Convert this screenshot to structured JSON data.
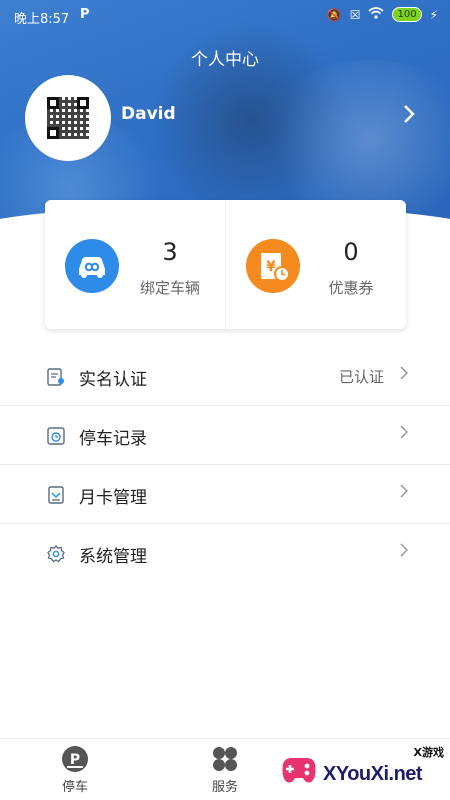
{
  "status_bar": {
    "time": "晚上8:57",
    "app_indicator": "P",
    "battery": "100"
  },
  "header": {
    "title": "个人中心",
    "user_name": "David"
  },
  "stats": [
    {
      "value": "3",
      "label": "绑定车辆",
      "icon": "car-link-icon",
      "color": "#2f8be8"
    },
    {
      "value": "0",
      "label": "优惠券",
      "icon": "coupon-icon",
      "color": "#f58a1f"
    }
  ],
  "menu": [
    {
      "label": "实名认证",
      "value": "已认证",
      "icon": "id-card-icon"
    },
    {
      "label": "停车记录",
      "value": "",
      "icon": "parking-record-icon"
    },
    {
      "label": "月卡管理",
      "value": "",
      "icon": "monthly-card-icon"
    },
    {
      "label": "系统管理",
      "value": "",
      "icon": "settings-icon"
    }
  ],
  "tabbar": [
    {
      "label": "停车",
      "icon": "parking-icon"
    },
    {
      "label": "服务",
      "icon": "grid-icon"
    }
  ],
  "watermark": {
    "text": "XYouXi.net",
    "small": "X游戏"
  },
  "colors": {
    "header_blue": "#2f6fc4",
    "accent_blue": "#2f8be8",
    "accent_orange": "#f58a1f"
  }
}
